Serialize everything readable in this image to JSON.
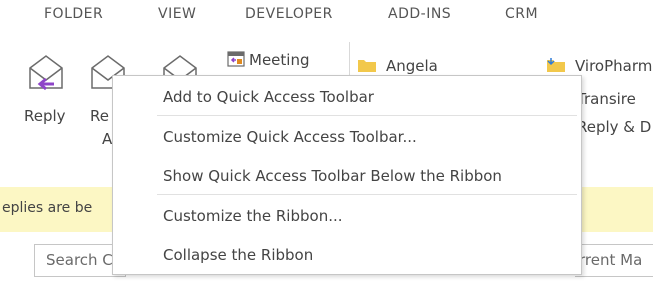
{
  "tabs": [
    "FOLDER",
    "VIEW",
    "DEVELOPER",
    "ADD-INS",
    "CRM"
  ],
  "ribbon": {
    "reply_label": "Reply",
    "reply_all_label_line1": "Re",
    "reply_all_label_line2": "A",
    "meeting_label": "Meeting"
  },
  "quick_steps": {
    "col1": [
      "Angela"
    ],
    "col2": [
      "ViroPharm",
      "Transire",
      "Reply & D"
    ]
  },
  "infobar": {
    "text": "eplies are be"
  },
  "search": {
    "left_text": "Search C",
    "right_text": "rrent Ma"
  },
  "context_menu": {
    "items": [
      "Add to Quick Access Toolbar",
      "Customize Quick Access Toolbar...",
      "Show Quick Access Toolbar Below the Ribbon",
      "Customize the Ribbon...",
      "Collapse the Ribbon"
    ]
  },
  "colors": {
    "accent_purple": "#8e44c8",
    "folder_yellow": "#f2c84b",
    "infobar_bg": "#fcf7c4"
  }
}
